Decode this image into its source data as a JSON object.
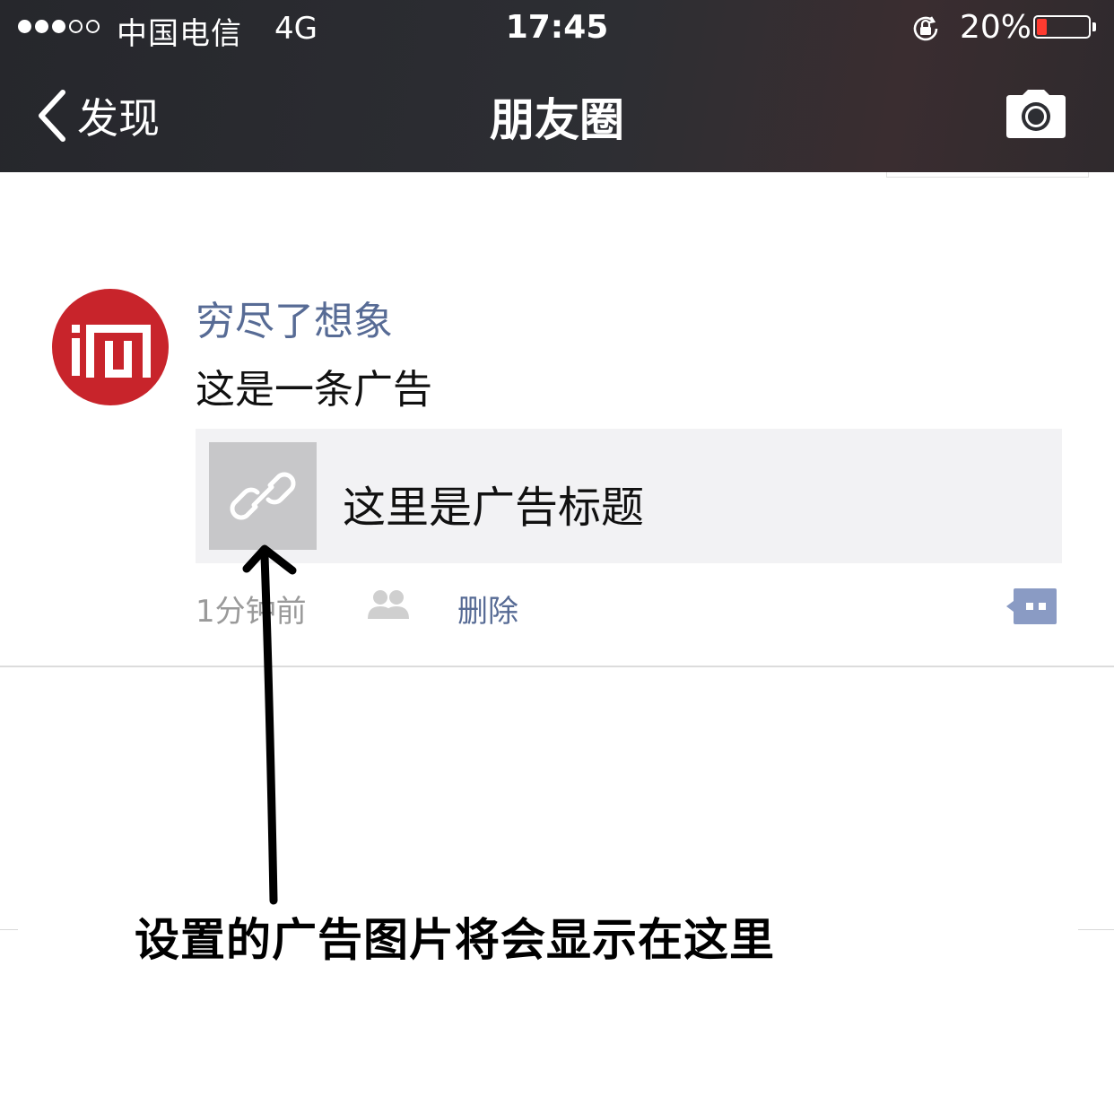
{
  "status_bar": {
    "carrier": "中国电信",
    "network": "4G",
    "time": "17:45",
    "battery": "20%",
    "battery_level": 0.2,
    "signal_bars_filled": 3,
    "signal_bars_total": 5
  },
  "nav": {
    "back_label": "发现",
    "title": "朋友圈",
    "camera_icon": "camera-icon"
  },
  "post": {
    "username": "穷尽了想象",
    "text": "这是一条广告",
    "link_title": "这里是广告标题",
    "time": "1分钟前",
    "delete_label": "删除"
  },
  "annotation": {
    "text": "设置的广告图片将会显示在这里"
  },
  "colors": {
    "nav_bg": "#2d2e33",
    "link_blue": "#576b95",
    "avatar_red": "#c8242b",
    "card_bg": "#f2f2f4",
    "thumb_bg": "#c7c7c9",
    "battery_red": "#ff3b30"
  }
}
